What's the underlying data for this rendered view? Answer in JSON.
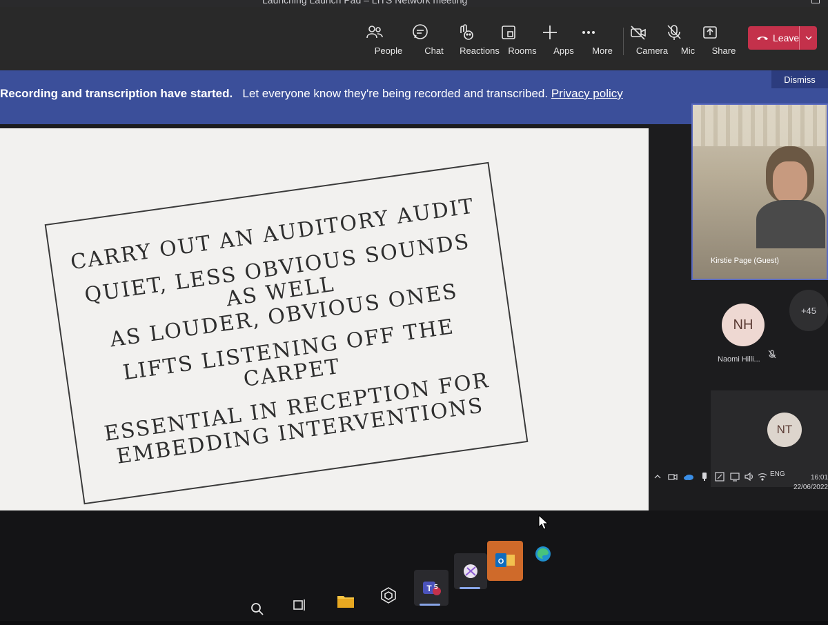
{
  "window": {
    "title": "Launching Launch Pad – LITS Network meeting"
  },
  "toolbar": {
    "items": [
      {
        "label": "People",
        "icon": "people-icon"
      },
      {
        "label": "Chat",
        "icon": "chat-icon"
      },
      {
        "label": "Reactions",
        "icon": "reactions-icon"
      },
      {
        "label": "Rooms",
        "icon": "rooms-icon"
      },
      {
        "label": "Apps",
        "icon": "plus-icon"
      },
      {
        "label": "More",
        "icon": "more-icon"
      },
      {
        "label": "Camera",
        "icon": "camera-off-icon"
      },
      {
        "label": "Mic",
        "icon": "mic-off-icon"
      },
      {
        "label": "Share",
        "icon": "share-icon"
      }
    ],
    "leave": {
      "label": "Leave",
      "color": "#c4314b"
    }
  },
  "banner": {
    "bold": "Recording and transcription have started.",
    "message": "Let everyone know they're being recorded and transcribed.",
    "link": "Privacy policy",
    "dismiss": "Dismiss",
    "color": "#3b4f9a"
  },
  "slide": {
    "lines": [
      "CARRY OUT AN AUDITORY AUDIT",
      "QUIET, LESS OBVIOUS SOUNDS AS WELL\nAS LOUDER, OBVIOUS ONES",
      "LIFTS LISTENING OFF THE CARPET",
      "ESSENTIAL IN RECEPTION FOR\nEMBEDDING INTERVENTIONS"
    ]
  },
  "participants": {
    "video": {
      "name": "Kirstie Page (Guest)"
    },
    "nh": {
      "initials": "NH",
      "name": "Naomi Hilli..."
    },
    "overflow": "+45",
    "nt": {
      "initials": "NT"
    }
  },
  "taskbar": {
    "clock": {
      "time": "16:01",
      "date": "22/06/2022"
    },
    "language": "ENG",
    "pinned": [
      {
        "icon": "search-icon"
      },
      {
        "icon": "task-view-icon"
      },
      {
        "icon": "file-explorer-icon"
      },
      {
        "icon": "app-cube-icon"
      },
      {
        "icon": "teams-icon",
        "badge": "5"
      },
      {
        "icon": "snipping-tool-icon"
      },
      {
        "icon": "outlook-icon"
      },
      {
        "icon": "edge-icon"
      }
    ]
  }
}
